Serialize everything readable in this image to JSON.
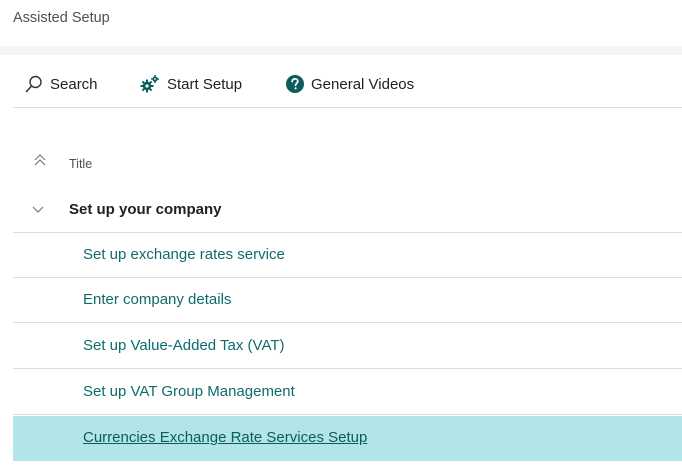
{
  "page": {
    "title": "Assisted Setup"
  },
  "actions": {
    "search": {
      "label": "Search",
      "icon": "search-icon"
    },
    "start_setup": {
      "label": "Start Setup",
      "icon": "gears-icon"
    },
    "general_videos": {
      "label": "General Videos",
      "icon": "help-circle-icon"
    }
  },
  "list": {
    "column_title": "Title",
    "group": {
      "label": "Set up your company",
      "expanded": true
    },
    "items": [
      {
        "label": "Set up exchange rates service",
        "selected": false
      },
      {
        "label": "Enter company details",
        "selected": false
      },
      {
        "label": "Set up Value-Added Tax (VAT)",
        "selected": false
      },
      {
        "label": "Set up VAT Group Management",
        "selected": false
      },
      {
        "label": "Currencies Exchange Rate Services Setup",
        "selected": true
      }
    ]
  },
  "colors": {
    "link": "#0f6b6b",
    "selected_row": "#b3e5e8",
    "icon_teal": "#0b5c5c"
  }
}
